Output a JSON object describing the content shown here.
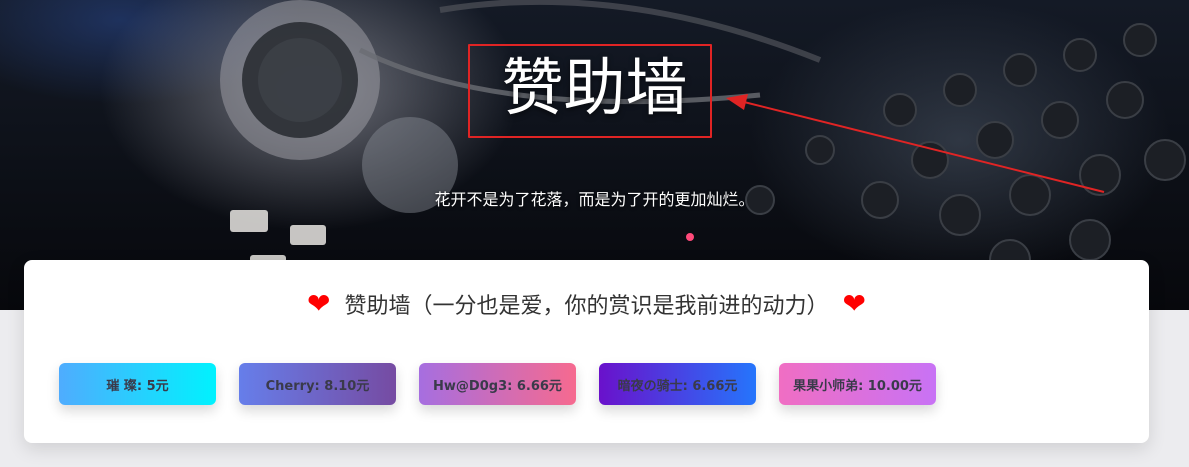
{
  "hero": {
    "title": "赞助墙",
    "subtitle": "花开不是为了花落，而是为了开的更加灿烂。"
  },
  "card": {
    "heading": "赞助墙（一分也是爱，你的赏识是我前进的动力）",
    "heart_left": "❤",
    "heart_right": "❤"
  },
  "sponsors": [
    {
      "label": "璀 璨: 5元"
    },
    {
      "label": "Cherry: 8.10元"
    },
    {
      "label": "Hw@D0g3: 6.66元"
    },
    {
      "label": "暗夜の骑士: 6.66元"
    },
    {
      "label": "果果小师弟: 10.00元"
    }
  ],
  "colors": {
    "annotation": "#e02424",
    "heart": "#ff0000"
  }
}
